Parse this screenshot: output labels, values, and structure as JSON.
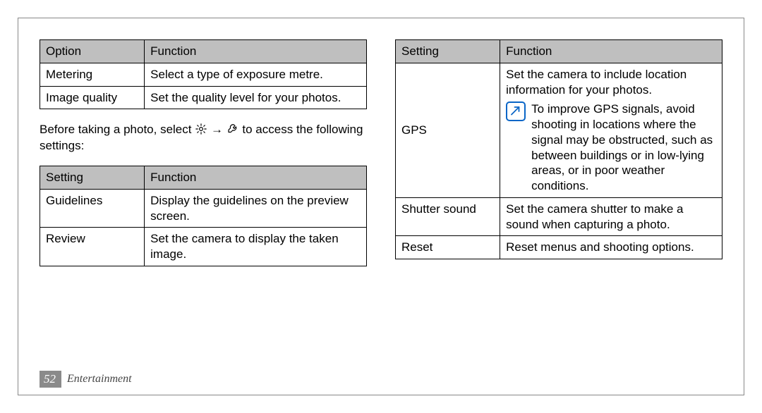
{
  "page_number": "52",
  "section": "Entertainment",
  "left": {
    "table1": {
      "head": {
        "c1": "Option",
        "c2": "Function"
      },
      "rows": [
        {
          "c1": "Metering",
          "c2": "Select a type of exposure metre."
        },
        {
          "c1": "Image quality",
          "c2": "Set the quality level for your photos."
        }
      ]
    },
    "intro_a": "Before taking a photo, select ",
    "intro_b": " → ",
    "intro_c": " to access the following settings:",
    "table2": {
      "head": {
        "c1": "Setting",
        "c2": "Function"
      },
      "rows": [
        {
          "c1": "Guidelines",
          "c2": "Display the guidelines on the preview screen."
        },
        {
          "c1": "Review",
          "c2": "Set the camera to display the taken image."
        }
      ]
    }
  },
  "right": {
    "table": {
      "head": {
        "c1": "Setting",
        "c2": "Function"
      },
      "rows": [
        {
          "c1": "GPS",
          "c2_lead": "Set the camera to include location information for your photos.",
          "note": "To improve GPS signals, avoid shooting in locations where the signal may be obstructed, such as between buildings or in low-lying areas, or in poor weather conditions."
        },
        {
          "c1": "Shutter sound",
          "c2": "Set the camera shutter to make a sound when capturing a photo."
        },
        {
          "c1": "Reset",
          "c2": "Reset menus and shooting options."
        }
      ]
    }
  }
}
